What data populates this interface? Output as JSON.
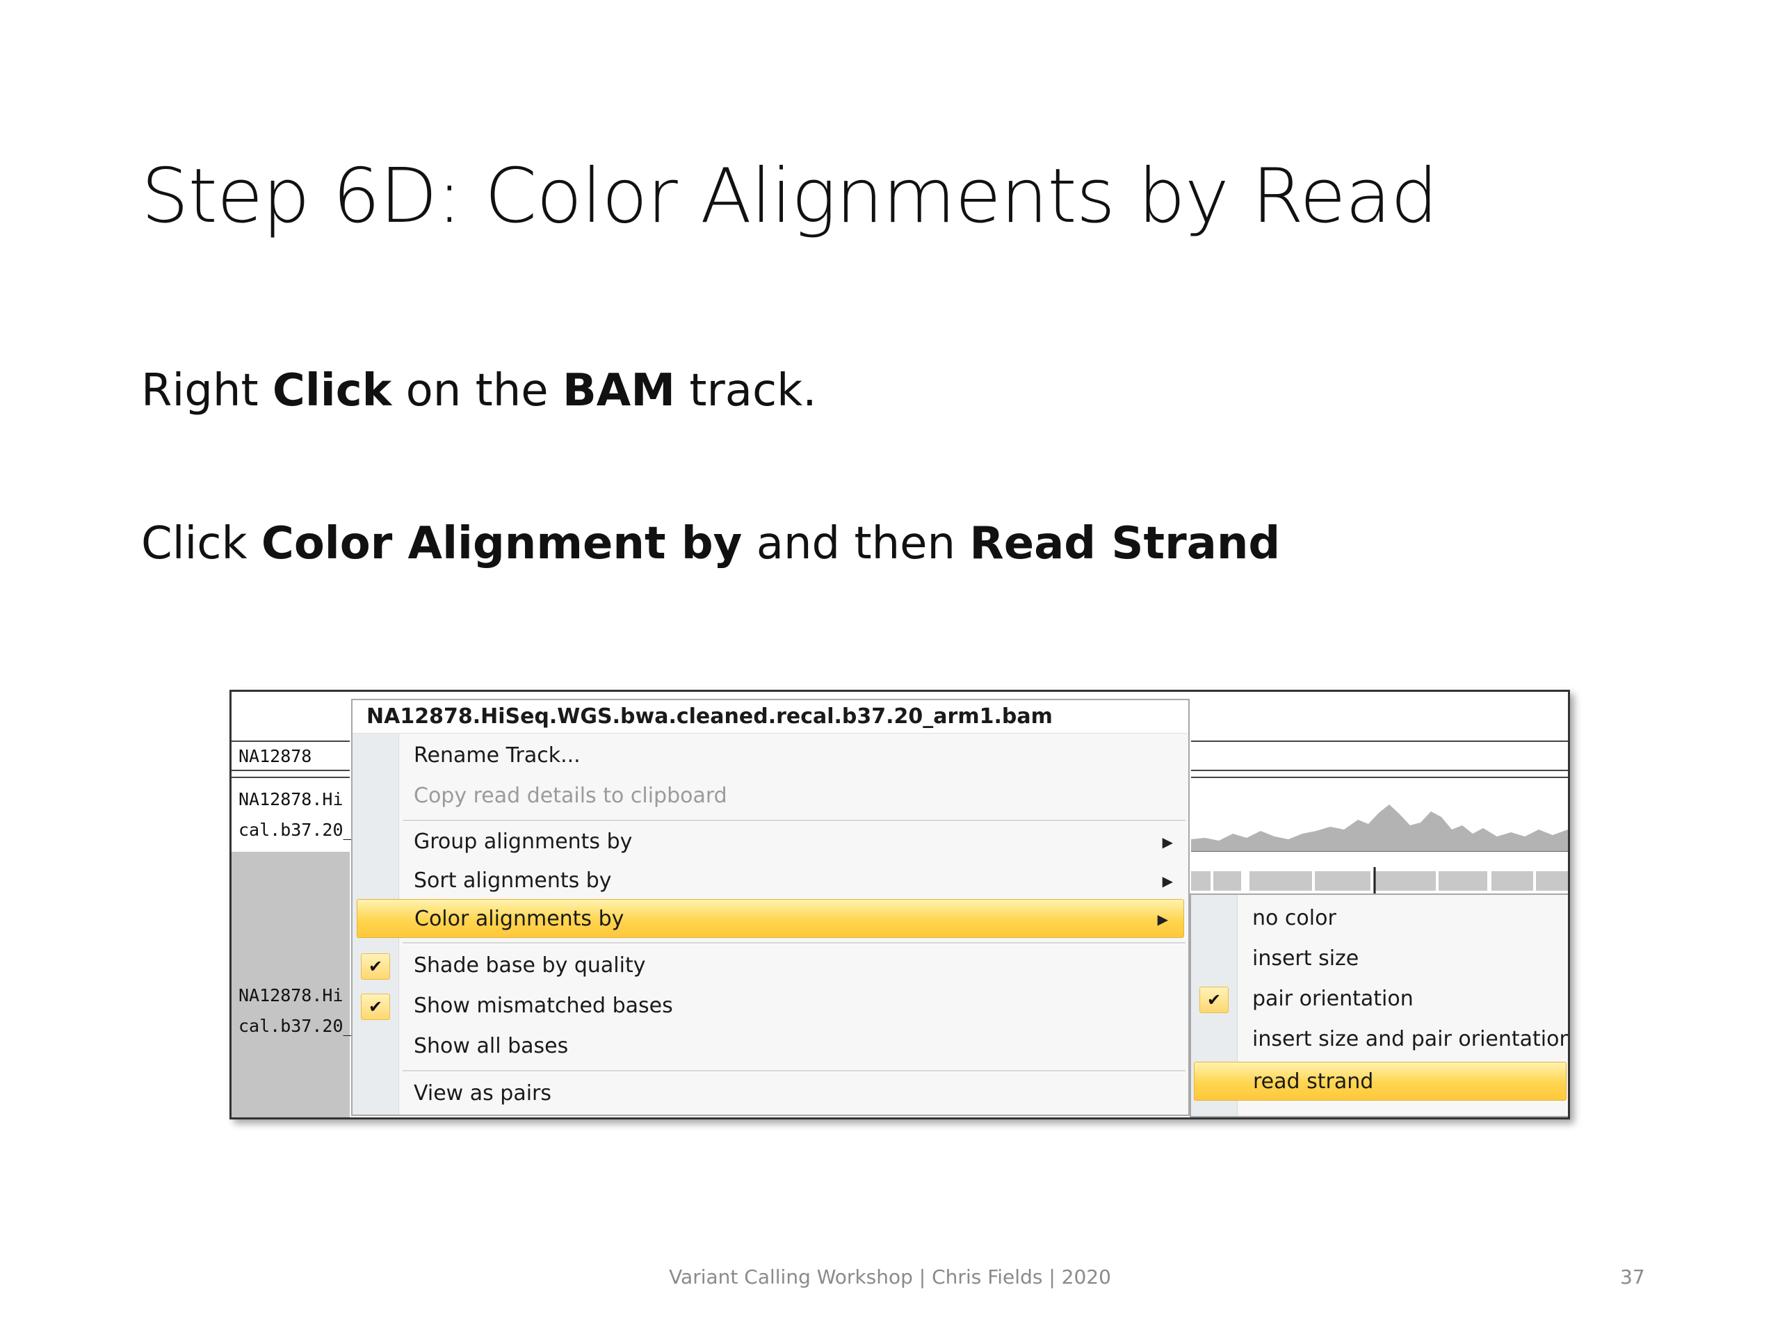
{
  "slide": {
    "title": "Step 6D: Color Alignments by Read",
    "bullet1": {
      "t1": "Right ",
      "b1": "Click",
      "t2": " on the ",
      "b2": "BAM",
      "t3": " track."
    },
    "bullet2": {
      "t1": "Click ",
      "b1": "Color Alignment by",
      "t2": " and then ",
      "b2": "Read Strand"
    },
    "footer": "Variant Calling Workshop | Chris Fields | 2020",
    "page_number": "37"
  },
  "screenshot": {
    "track_names": {
      "sample": "NA12878",
      "coverage_line1": "NA12878.Hi",
      "coverage_line2": "cal.b37.20_",
      "alignment_line1": "NA12878.Hi",
      "alignment_line2": "cal.b37.20_"
    },
    "context_menu": {
      "header": "NA12878.HiSeq.WGS.bwa.cleaned.recal.b37.20_arm1.bam",
      "items": [
        {
          "label": "Rename Track...",
          "enabled": true
        },
        {
          "label": "Copy read details to clipboard",
          "enabled": false
        },
        {
          "label": "Group alignments by",
          "submenu": true
        },
        {
          "label": "Sort alignments by",
          "submenu": true
        },
        {
          "label": "Color alignments by",
          "submenu": true,
          "highlighted": true
        },
        {
          "label": "Shade base by quality",
          "checked": true
        },
        {
          "label": "Show mismatched bases",
          "checked": true
        },
        {
          "label": "Show all bases",
          "checked": false
        },
        {
          "label": "View as pairs",
          "checked": false
        }
      ]
    },
    "submenu": {
      "items": [
        {
          "label": "no color"
        },
        {
          "label": "insert size"
        },
        {
          "label": "pair orientation",
          "checked": true
        },
        {
          "label": "insert size and pair orientation"
        },
        {
          "label": "read strand",
          "highlighted": true
        }
      ]
    },
    "icons": {
      "check": "check-icon",
      "submenu_arrow": "triangle-right-icon"
    },
    "colors": {
      "highlight": "#ffd54f",
      "menu_bg": "#f7f7f7",
      "track_gray": "#c4c4c4"
    }
  }
}
